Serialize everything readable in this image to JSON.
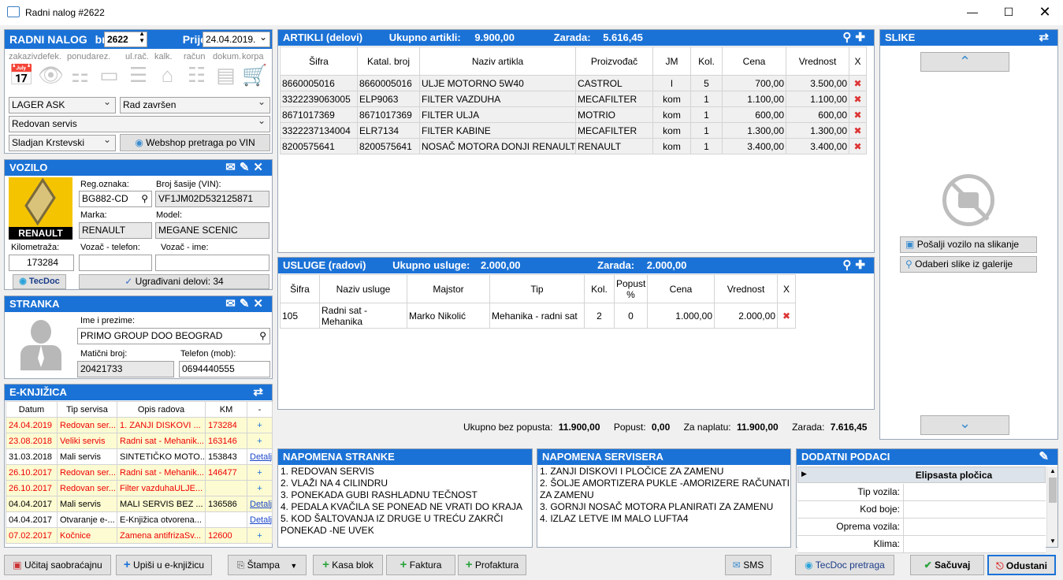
{
  "window": {
    "title": "Radni nalog #2622"
  },
  "order": {
    "header": "RADNI NALOG",
    "br_label": "br.",
    "number": "2622",
    "prijem_label": "Prijem:",
    "date": "24.04.2019.",
    "tools": [
      "zakaziv.",
      "defek.",
      "ponuda",
      "rez.",
      "ul.rač.",
      "kalk.",
      "račun",
      "dokum.",
      "korpa"
    ],
    "lager": "LAGER ASK",
    "status": "Rad završen",
    "service": "Redovan servis",
    "worker": "Sladjan  Krstevski",
    "webshop_btn": "Webshop pretraga po VIN"
  },
  "vehicle": {
    "header": "VOZILO",
    "logo_text": "RENAULT",
    "reg_label": "Reg.oznaka:",
    "reg": "BG882-CD",
    "vin_label": "Broj šasije (VIN):",
    "vin": "VF1JM02D532125871",
    "marka_label": "Marka:",
    "marka": "RENAULT",
    "model_label": "Model:",
    "model": "MEGANE SCENIC",
    "km_label": "Kilometraža:",
    "km": "173284",
    "phone_label": "Vozač - telefon:",
    "phone": "",
    "name_label": "Vozač - ime:",
    "name": "",
    "tecdoc_logo": "TecDoc",
    "parts_btn": "Ugrađivani delovi: 34"
  },
  "client": {
    "header": "STRANKA",
    "name_label": "Ime i prezime:",
    "name": "PRIMO GROUP DOO BEOGRAD",
    "mb_label": "Matični broj:",
    "mb": "20421733",
    "phone_label": "Telefon (mob):",
    "phone": "0694440555"
  },
  "ebook": {
    "header": "E-KNJIŽICA",
    "columns": [
      "Datum",
      "Tip servisa",
      "Opis radova",
      "KM",
      "-"
    ],
    "rows": [
      {
        "date": "24.04.2019",
        "type": "Redovan ser...",
        "desc": "1. ZANJI DISKOVI ...",
        "km": "173284",
        "action": "+",
        "style": "red-yellow"
      },
      {
        "date": "23.08.2018",
        "type": "Veliki servis",
        "desc": "Radni sat - Mehanik...",
        "km": "163146",
        "action": "+",
        "style": "red-yellow"
      },
      {
        "date": "31.03.2018",
        "type": "Mali servis",
        "desc": "SINTETIČKO MOTO...",
        "km": "153843",
        "action": "Detalji",
        "style": "black"
      },
      {
        "date": "26.10.2017",
        "type": "Redovan ser...",
        "desc": "Radni sat - Mehanik...",
        "km": "146477",
        "action": "+",
        "style": "red-yellow"
      },
      {
        "date": "26.10.2017",
        "type": "Redovan ser...",
        "desc": "Filter vazduhaULJE...",
        "km": "",
        "action": "+",
        "style": "red-yellow"
      },
      {
        "date": "04.04.2017",
        "type": "Mali servis",
        "desc": "MALI SERVIS BEZ ...",
        "km": "136586",
        "action": "Detalji",
        "style": "black-yellow"
      },
      {
        "date": "04.04.2017",
        "type": "Otvaranje e-...",
        "desc": "E-Knjižica otvorena...",
        "km": "",
        "action": "Detalji",
        "style": "black"
      },
      {
        "date": "07.02.2017",
        "type": "Kočnice",
        "desc": "Zamena antifrizaSv...",
        "km": "12600",
        "action": "+",
        "style": "red-yellow"
      }
    ]
  },
  "articles": {
    "header": "ARTIKLI (delovi)",
    "total_label": "Ukupno artikli:",
    "total": "9.900,00",
    "profit_label": "Zarada:",
    "profit": "5.616,45",
    "columns": [
      "Šifra",
      "Katal. broj",
      "Naziv artikla",
      "Proizvođač",
      "JM",
      "Kol.",
      "Cena",
      "Vrednost",
      "X"
    ],
    "rows": [
      [
        "8660005016",
        "8660005016",
        "ULJE MOTORNO 5W40",
        "CASTROL",
        "l",
        "5",
        "700,00",
        "3.500,00"
      ],
      [
        "3322239063005",
        "ELP9063",
        "FILTER VAZDUHA",
        "MECAFILTER",
        "kom",
        "1",
        "1.100,00",
        "1.100,00"
      ],
      [
        "8671017369",
        "8671017369",
        "FILTER ULJA",
        "MOTRIO",
        "kom",
        "1",
        "600,00",
        "600,00"
      ],
      [
        "3322237134004",
        "ELR7134",
        "FILTER KABINE",
        "MECAFILTER",
        "kom",
        "1",
        "1.300,00",
        "1.300,00"
      ],
      [
        "8200575641",
        "8200575641",
        "NOSAČ MOTORA DONJI RENAULT",
        "RENAULT",
        "kom",
        "1",
        "3.400,00",
        "3.400,00"
      ]
    ]
  },
  "services": {
    "header": "USLUGE (radovi)",
    "total_label": "Ukupno usluge:",
    "total": "2.000,00",
    "profit_label": "Zarada:",
    "profit": "2.000,00",
    "columns": [
      "Šifra",
      "Naziv usluge",
      "Majstor",
      "Tip",
      "Kol.",
      "Popust %",
      "Cena",
      "Vrednost",
      "X"
    ],
    "rows": [
      [
        "105",
        "Radni sat - Mehanika",
        "Marko Nikolić",
        "Mehanika - radni sat",
        "2",
        "0",
        "1.000,00",
        "2.000,00"
      ]
    ]
  },
  "totals": {
    "no_discount_label": "Ukupno bez popusta:",
    "no_discount": "11.900,00",
    "discount_label": "Popust:",
    "discount": "0,00",
    "pay_label": "Za naplatu:",
    "pay": "11.900,00",
    "profit_label": "Zarada:",
    "profit": "7.616,45"
  },
  "images": {
    "header": "SLIKE",
    "send_btn": "Pošalji vozilo na slikanje",
    "gallery_btn": "Odaberi slike iz galerije"
  },
  "notes": {
    "client_header": "NAPOMENA STRANKE",
    "client_text": "1. REDOVAN SERVIS\n2. VLAŽI NA 4 CILINDRU\n3. PONEKADA GUBI RASHLADNU TEČNOST\n4. PEDALA KVAČILA SE PONEAD NE VRATI DO KRAJA\n5. KOD ŠALTOVANJA IZ DRUGE U TREĆU ZAKRČI\nPONEKAD -NE UVEK",
    "service_header": "NAPOMENA SERVISERA",
    "service_text": "1. ZANJI DISKOVI I PLOČICE ZA ZAMENU\n2. ŠOLJE AMORTIZERA PUKLE -AMORIZERE RAČUNATI\nZA ZAMENU\n3. GORNJI NOSAČ MOTORA PLANIRATI ZA ZAMENU\n4. IZLAZ LETVE IM MALO LUFTA4"
  },
  "extra": {
    "header": "DODATNI PODACI",
    "group": "Elipsasta pločica",
    "rows": [
      "Tip vozila:",
      "Kod boje:",
      "Oprema vozila:",
      "Klima:"
    ]
  },
  "bottom": {
    "ucitaj": "Učitaj saobraćajnu",
    "upisi": "Upiši u e-knjižicu",
    "stampa": "Štampa",
    "kasa": "Kasa blok",
    "faktura": "Faktura",
    "profaktura": "Profaktura",
    "sms": "SMS",
    "tecdoc": "TecDoc pretraga",
    "sacuvaj": "Sačuvaj",
    "odustani": "Odustani"
  }
}
